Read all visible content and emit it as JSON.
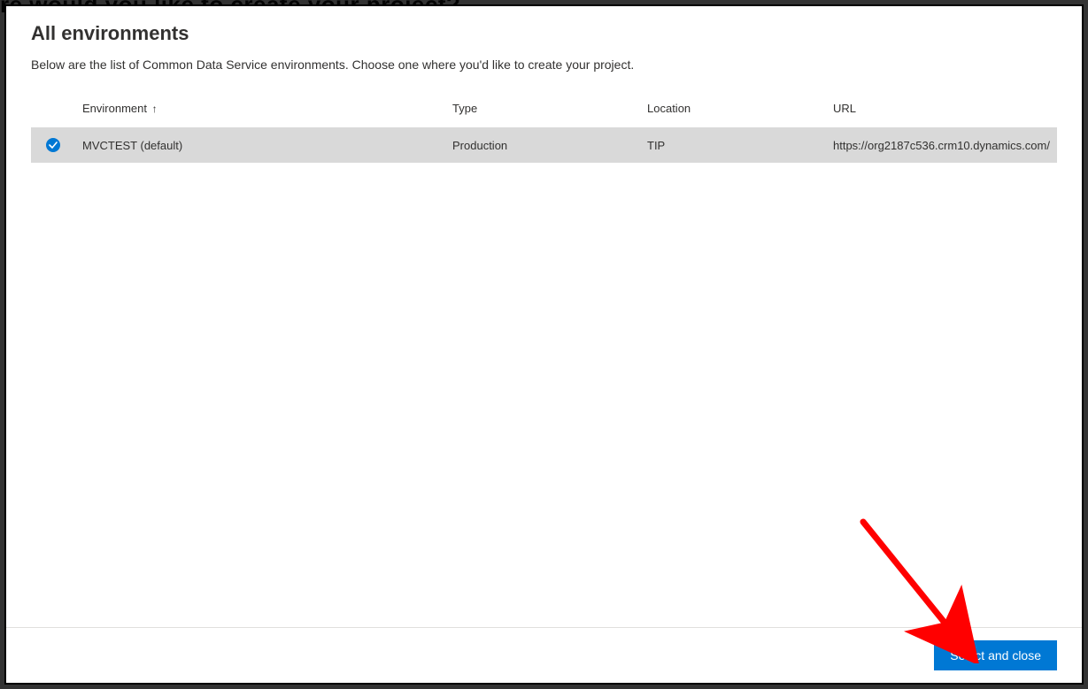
{
  "background_heading_fragment": "re would you like to create your project?",
  "title": "All environments",
  "subtitle": "Below are the list of Common Data Service environments. Choose one where you'd like to create your project.",
  "table": {
    "headers": {
      "environment": "Environment",
      "type": "Type",
      "location": "Location",
      "url": "URL"
    },
    "sort": {
      "column": "environment",
      "direction": "asc",
      "indicator": "↑"
    },
    "rows": [
      {
        "selected": true,
        "environment": "MVCTEST (default)",
        "type": "Production",
        "location": "TIP",
        "url": "https://org2187c536.crm10.dynamics.com/"
      }
    ]
  },
  "footer": {
    "primary_button": "Select and close"
  }
}
